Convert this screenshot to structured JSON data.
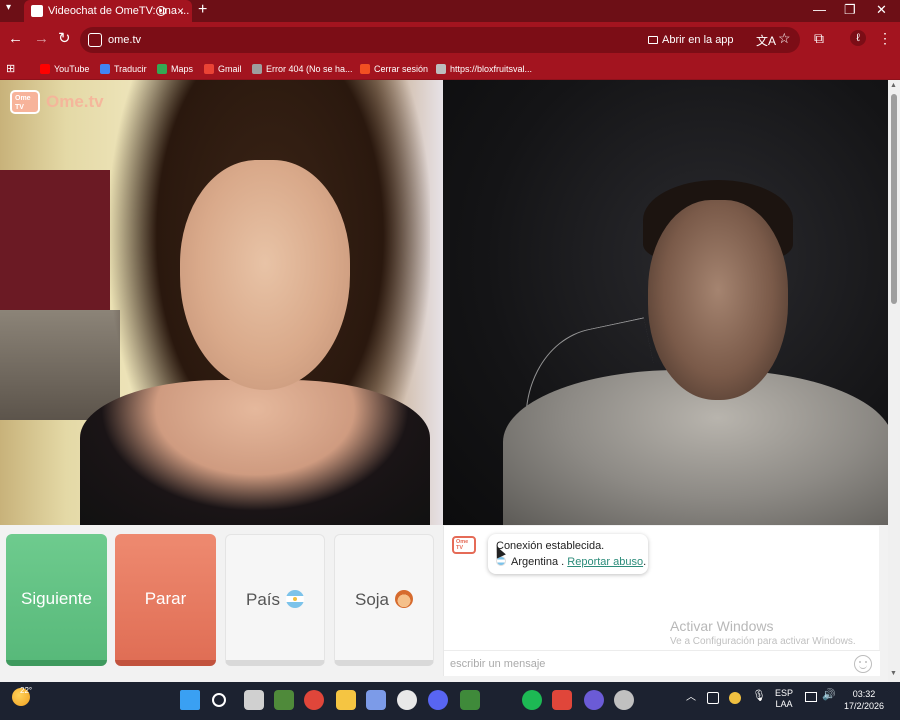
{
  "browser": {
    "tab_title": "Videochat de OmeTV: una ...",
    "tab_close": "×",
    "new_tab": "+",
    "url": "ome.tv",
    "open_in_app": "Abrir en la app",
    "window_controls": {
      "minimize": "—",
      "restore": "❐",
      "close": "✕"
    },
    "nav": {
      "back": "←",
      "forward": "→",
      "reload": "↻"
    }
  },
  "bookmarks": [
    {
      "label": "YouTube",
      "color": "#ff0000"
    },
    {
      "label": "Traducir",
      "color": "#4285f4"
    },
    {
      "label": "Maps",
      "color": "#34a853"
    },
    {
      "label": "Gmail",
      "color": "#ea4335"
    },
    {
      "label": "Error 404 (No se ha...",
      "color": "#9e9e9e"
    },
    {
      "label": "Cerrar sesión",
      "color": "#f25022"
    },
    {
      "label": "https://bloxfruitsval...",
      "color": "#bdbdbd"
    }
  ],
  "video": {
    "logo_text": "Ome.tv",
    "logo_box": "Ome TV"
  },
  "controls": {
    "next_label": "Siguiente",
    "stop_label": "Parar",
    "country_label": "País",
    "gender_label": "Soja"
  },
  "chat": {
    "system_line1": "Conexión establecida.",
    "country": "Argentina",
    "separator": ".",
    "report_link": "Reportar abuso",
    "report_suffix": ".",
    "input_placeholder": "escribir un mensaje",
    "watermark_title": "Activar Windows",
    "watermark_sub": "Ve a Configuración para activar Windows."
  },
  "taskbar": {
    "temperature": "22°",
    "lang_line1": "ESP",
    "lang_line2": "LAA",
    "time": "03:32",
    "date": "17/2/2026",
    "apps": [
      {
        "name": "start-icon",
        "color": "#3aa0f3"
      },
      {
        "name": "search-icon",
        "color": "#ffffff"
      },
      {
        "name": "task-view-icon",
        "color": "#d0d0d0"
      },
      {
        "name": "minecraft-launcher-icon",
        "color": "#4f8a3a"
      },
      {
        "name": "chrome-icon",
        "color": "#e0463a"
      },
      {
        "name": "file-explorer-icon",
        "color": "#f5c542"
      },
      {
        "name": "store-icon",
        "color": "#7c9be8"
      },
      {
        "name": "clock-icon",
        "color": "#e8e8e8"
      },
      {
        "name": "discord-icon",
        "color": "#5865f2"
      },
      {
        "name": "minecraft-icon",
        "color": "#3f8a3a"
      },
      {
        "name": "spotify-icon",
        "color": "#1db954"
      },
      {
        "name": "microphone-icon",
        "color": "#e0463a"
      },
      {
        "name": "circle-app-icon",
        "color": "#6b5bd6"
      },
      {
        "name": "app-icon",
        "color": "#c0c0c0"
      }
    ]
  }
}
